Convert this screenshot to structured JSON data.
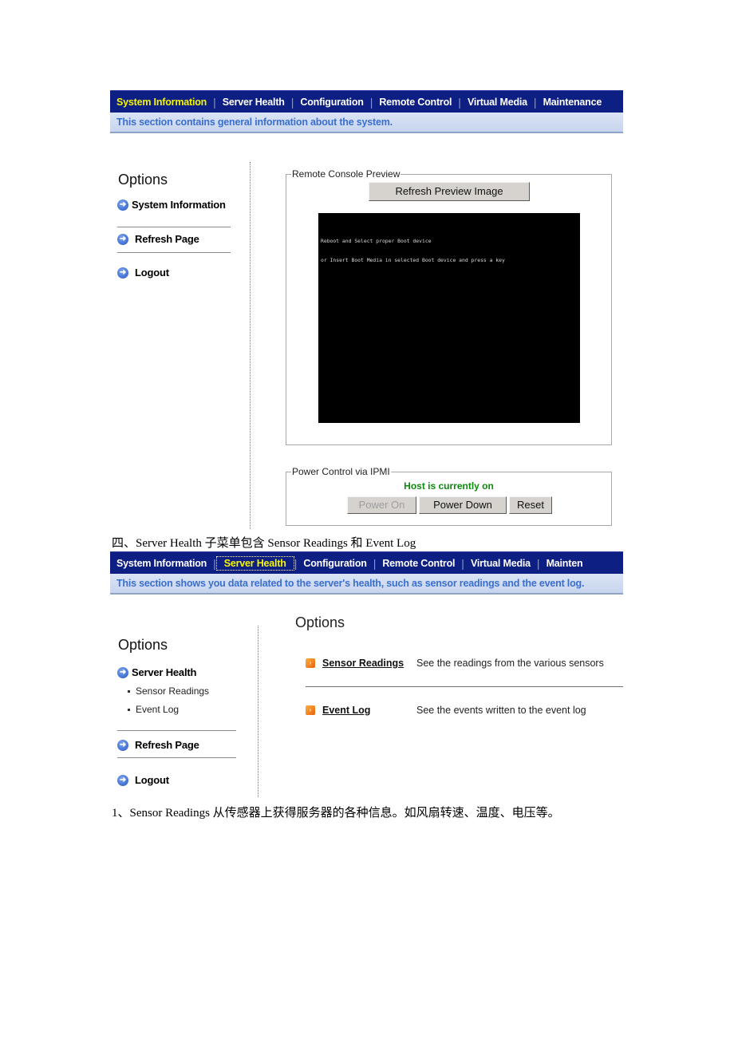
{
  "screenshot1": {
    "nav": {
      "items": [
        {
          "label": "System Information",
          "active": true
        },
        {
          "label": "Server Health"
        },
        {
          "label": "Configuration"
        },
        {
          "label": "Remote Control"
        },
        {
          "label": "Virtual Media"
        },
        {
          "label": "Maintenance"
        }
      ]
    },
    "subheader": "This section contains general information about the system.",
    "sidebar": {
      "title": "Options",
      "items": [
        {
          "label": "System Information",
          "icon": "arrow-circle-icon"
        },
        {
          "label": "Refresh Page",
          "icon": "arrow-circle-icon"
        },
        {
          "label": "Logout",
          "icon": "arrow-circle-icon"
        }
      ]
    },
    "remote_console": {
      "legend": "Remote Console Preview",
      "refresh_button": "Refresh Preview Image",
      "console_lines": [
        "Reboot and Select proper Boot device",
        "or Insert Boot Media in selected Boot device and press a key"
      ]
    },
    "power_control": {
      "legend": "Power Control via IPMI",
      "status": "Host is currently on",
      "status_color": "#0d8a0d",
      "buttons": [
        {
          "label": "Power On",
          "disabled": true
        },
        {
          "label": "Power Down"
        },
        {
          "label": "Reset"
        }
      ]
    }
  },
  "caption1": "四、Server Health 子菜单包含 Sensor Readings 和 Event Log",
  "screenshot2": {
    "nav": {
      "items": [
        {
          "label": "System Information"
        },
        {
          "label": "Server Health",
          "active": true
        },
        {
          "label": "Configuration"
        },
        {
          "label": "Remote Control"
        },
        {
          "label": "Virtual Media"
        },
        {
          "label": "Mainten"
        }
      ]
    },
    "subheader": "This section shows you data related to the server's health, such as sensor readings and the event log.",
    "sidebar": {
      "title": "Options",
      "section": "Server Health",
      "subitems": [
        "Sensor Readings",
        "Event Log"
      ],
      "items": [
        {
          "label": "Refresh Page"
        },
        {
          "label": "Logout"
        }
      ]
    },
    "main": {
      "title": "Options",
      "links": [
        {
          "label": "Sensor Readings",
          "description": "See the readings from the various sensors"
        },
        {
          "label": "Event Log",
          "description": "See the events written to the event log"
        }
      ]
    }
  },
  "caption2": "1、Sensor Readings 从传感器上获得服务器的各种信息。如风扇转速、温度、电压等。",
  "colors": {
    "nav_bg": "#0d1f82",
    "nav_active": "#f6f600",
    "subheader_text": "#3a6fd0"
  }
}
